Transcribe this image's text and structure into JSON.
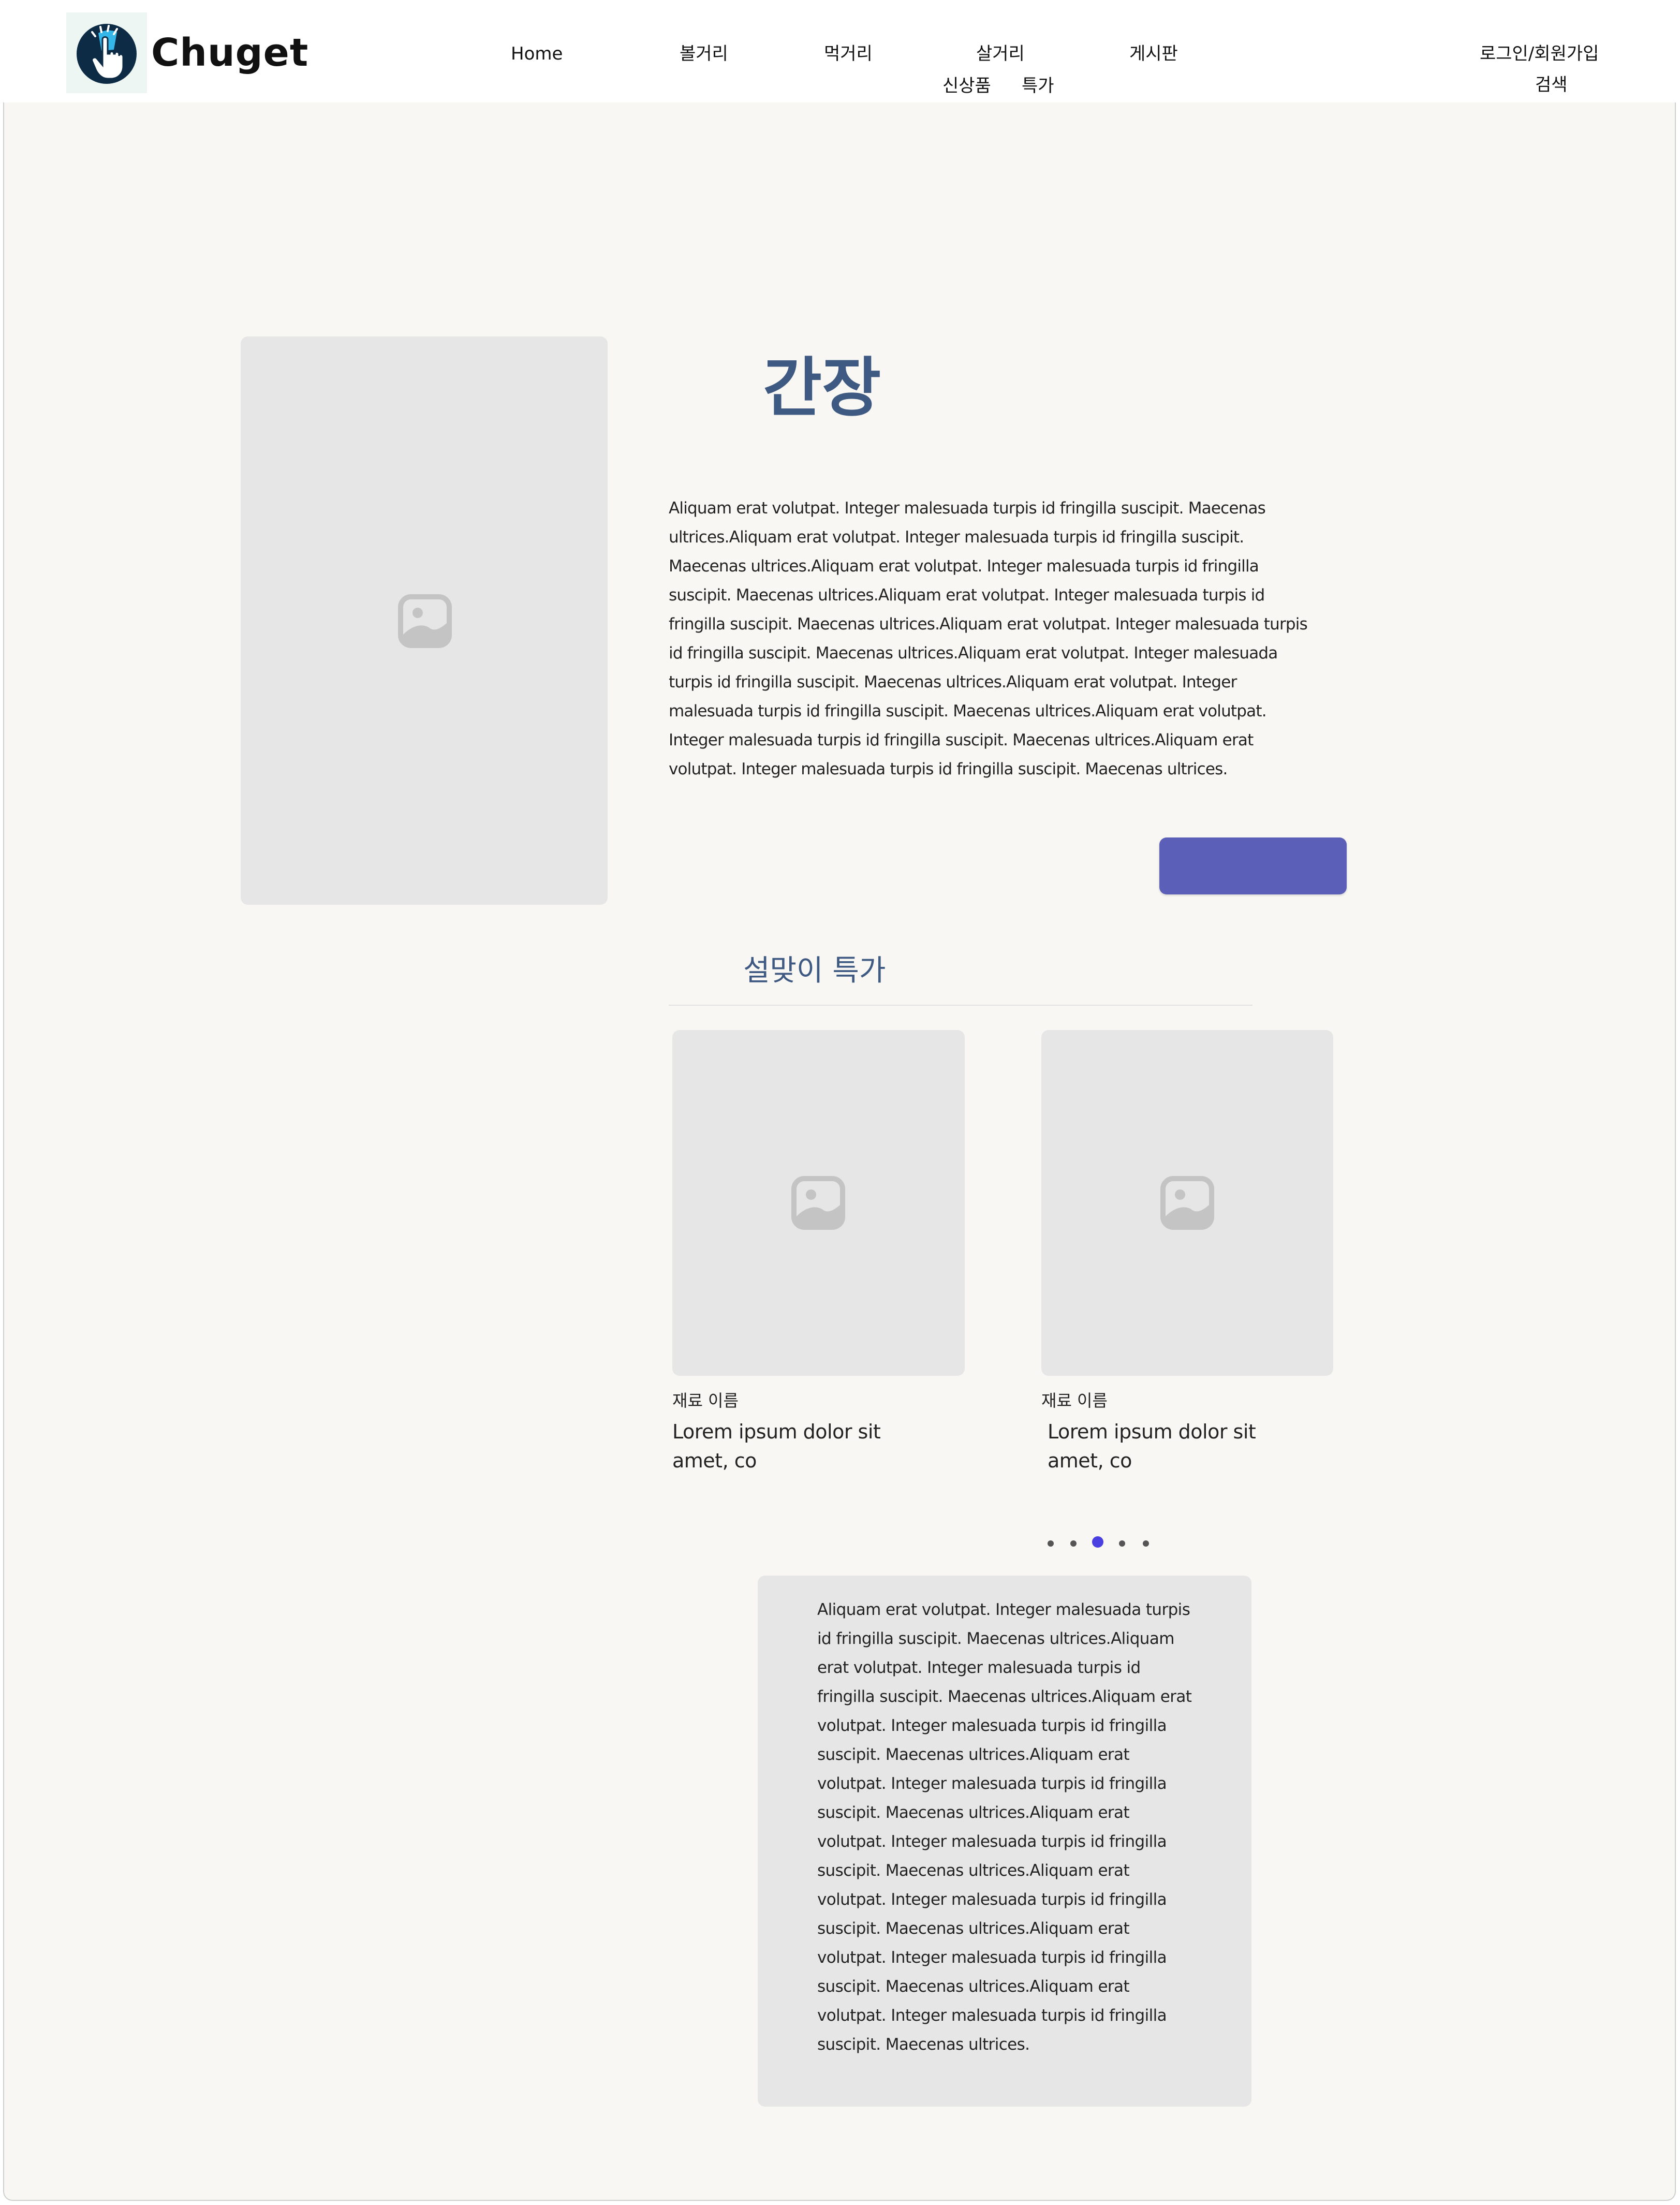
{
  "header": {
    "brand": "Chuget",
    "nav": {
      "home": "Home",
      "sights": "볼거리",
      "food": "먹거리",
      "shopping": "살거리",
      "board": "게시판",
      "new_products": "신상품",
      "special": "특가",
      "login": "로그인/회원가입",
      "search": "검색"
    }
  },
  "product": {
    "title": "간장",
    "description": "Aliquam erat volutpat. Integer malesuada turpis id fringilla suscipit. Maecenas ultrices.Aliquam erat volutpat. Integer malesuada turpis id fringilla suscipit. Maecenas ultrices.Aliquam erat volutpat. Integer malesuada turpis id fringilla suscipit. Maecenas ultrices.Aliquam erat volutpat. Integer malesuada turpis id fringilla suscipit. Maecenas ultrices.Aliquam erat volutpat. Integer malesuada turpis id fringilla suscipit. Maecenas ultrices.Aliquam erat volutpat. Integer malesuada turpis id fringilla suscipit. Maecenas ultrices.Aliquam erat volutpat. Integer malesuada turpis id fringilla suscipit. Maecenas ultrices.Aliquam erat volutpat. Integer malesuada turpis id fringilla suscipit. Maecenas ultrices.Aliquam erat volutpat. Integer malesuada turpis id fringilla suscipit. Maecenas ultrices.",
    "image_icon": "image-placeholder-icon",
    "button_label": ""
  },
  "promo": {
    "title": "설맞이 특가",
    "items": [
      {
        "name": "재료 이름",
        "desc": "Lorem ipsum dolor sit amet, co",
        "icon": "image-placeholder-icon"
      },
      {
        "name": "재료 이름",
        "desc": "Lorem ipsum dolor sit amet, co",
        "icon": "image-placeholder-icon"
      }
    ],
    "carousel": {
      "count": 5,
      "active": 3
    }
  },
  "info": {
    "text": "Aliquam erat volutpat. Integer malesuada turpis id fringilla suscipit. Maecenas ultrices.Aliquam erat volutpat. Integer malesuada turpis id fringilla suscipit. Maecenas ultrices.Aliquam erat volutpat. Integer malesuada turpis id fringilla suscipit. Maecenas ultrices.Aliquam erat volutpat. Integer malesuada turpis id fringilla suscipit. Maecenas ultrices.Aliquam erat volutpat. Integer malesuada turpis id fringilla suscipit. Maecenas ultrices.Aliquam erat volutpat. Integer malesuada turpis id fringilla suscipit. Maecenas ultrices.Aliquam erat volutpat. Integer malesuada turpis id fringilla suscipit. Maecenas ultrices.Aliquam erat volutpat. Integer malesuada turpis id fringilla suscipit. Maecenas ultrices."
  },
  "colors": {
    "accent": "#5b5fb8",
    "heading": "#3f5a82",
    "background": "#f8f7f3",
    "placeholder": "#e6e6e6",
    "active_dot": "#4a3fe0"
  }
}
